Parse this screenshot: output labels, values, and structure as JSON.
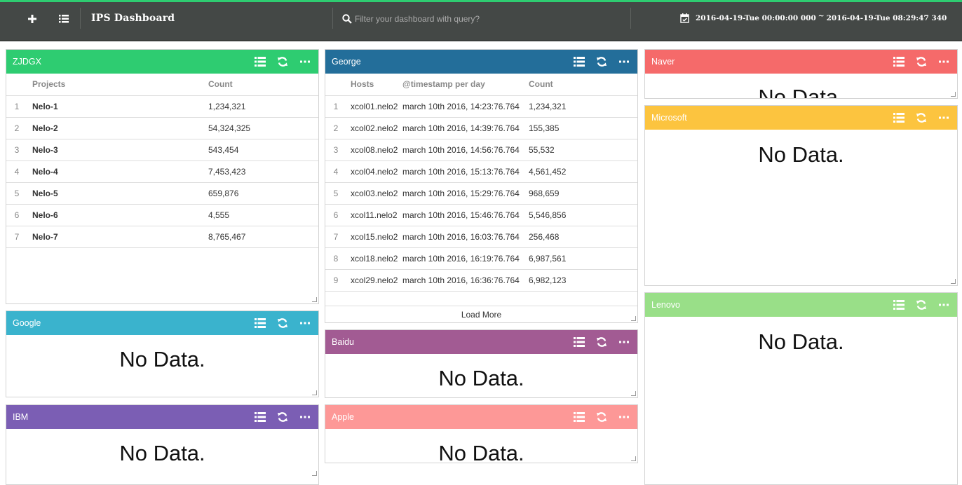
{
  "header": {
    "title": "IPS Dashboard",
    "search_placeholder": "Filter your dashboard with query?",
    "date_start": "2016-04-19-Tue 00:00:00 000",
    "date_sep": "~",
    "date_end": "2016-04-19-Tue 08:29:47 340",
    "accent_color": "#2ecc71",
    "icons": [
      "plus-icon",
      "list-icon",
      "search-icon",
      "calendar-icon"
    ]
  },
  "panel_tools": [
    "list-icon",
    "refresh-icon",
    "more-icon"
  ],
  "no_data": "No Data.",
  "panels": {
    "zjdgx": {
      "title": "ZJDGX",
      "color": "#2ecc71",
      "columns": [
        "Projects",
        "Count"
      ],
      "rows": [
        {
          "n": "1",
          "name": "Nelo-1",
          "count": "1,234,321"
        },
        {
          "n": "2",
          "name": "Nelo-2",
          "count": "54,324,325"
        },
        {
          "n": "3",
          "name": "Nelo-3",
          "count": "543,454"
        },
        {
          "n": "4",
          "name": "Nelo-4",
          "count": "7,453,423"
        },
        {
          "n": "5",
          "name": "Nelo-5",
          "count": "659,876"
        },
        {
          "n": "6",
          "name": "Nelo-6",
          "count": "4,555"
        },
        {
          "n": "7",
          "name": "Nelo-7",
          "count": "8,765,467"
        }
      ]
    },
    "george": {
      "title": "George",
      "color": "#236e9a",
      "columns": [
        "Hosts",
        "@timestamp per day",
        "Count"
      ],
      "rows": [
        {
          "n": "1",
          "host": "xcol01.nelo2",
          "ts": "march 10th 2016, 14:23:76.764",
          "count": "1,234,321"
        },
        {
          "n": "2",
          "host": "xcol02.nelo2",
          "ts": "march 10th 2016, 14:39:76.764",
          "count": "155,385"
        },
        {
          "n": "3",
          "host": "xcol08.nelo2",
          "ts": "march 10th 2016, 14:56:76.764",
          "count": "55,532"
        },
        {
          "n": "4",
          "host": "xcol04.nelo2",
          "ts": "march 10th 2016, 15:13:76.764",
          "count": "4,561,452"
        },
        {
          "n": "5",
          "host": "xcol03.nelo2",
          "ts": "march 10th 2016, 15:29:76.764",
          "count": "968,659"
        },
        {
          "n": "6",
          "host": "xcol11.nelo2",
          "ts": "march 10th 2016, 15:46:76.764",
          "count": "5,546,856"
        },
        {
          "n": "7",
          "host": "xcol15.nelo2",
          "ts": "march 10th 2016, 16:03:76.764",
          "count": "256,468"
        },
        {
          "n": "8",
          "host": "xcol18.nelo2",
          "ts": "march 10th 2016, 16:19:76.764",
          "count": "6,987,561"
        },
        {
          "n": "9",
          "host": "xcol29.nelo2",
          "ts": "march 10th 2016, 16:36:76.764",
          "count": "6,982,123"
        }
      ],
      "load_more": "Load More"
    },
    "naver": {
      "title": "Naver",
      "color": "#f56a6a"
    },
    "microsoft": {
      "title": "Microsoft",
      "color": "#fcc43f"
    },
    "google": {
      "title": "Google",
      "color": "#3ab3cd"
    },
    "baidu": {
      "title": "Baidu",
      "color": "#a25b93"
    },
    "lenovo": {
      "title": "Lenovo",
      "color": "#99df88"
    },
    "ibm": {
      "title": "IBM",
      "color": "#7b5eb4"
    },
    "apple": {
      "title": "Apple",
      "color": "#fd9897"
    }
  }
}
